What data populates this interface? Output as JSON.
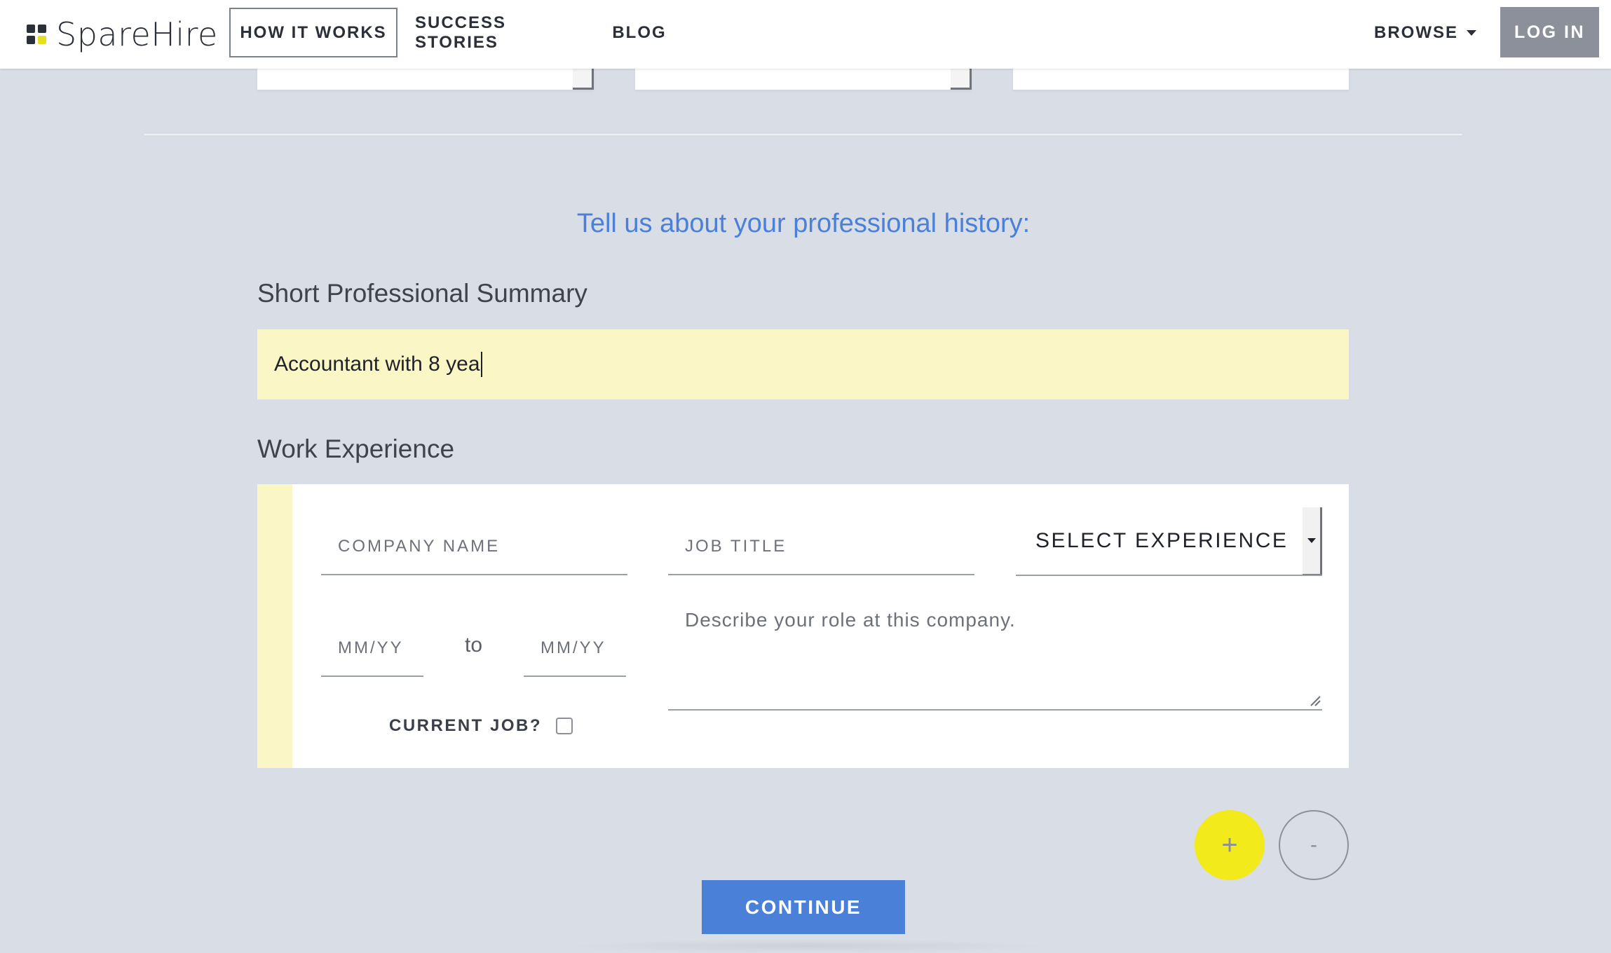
{
  "nav": {
    "logo_text": "SpareHire",
    "items": [
      {
        "label": "HOW IT WORKS"
      },
      {
        "label": "SUCCESS STORIES"
      },
      {
        "label": "BLOG"
      }
    ],
    "browse_label": "BROWSE",
    "login_label": "LOG IN"
  },
  "form": {
    "section_title": "Tell us about your professional history:",
    "summary_label": "Short Professional Summary",
    "summary_value": "Accountant with 8 yea",
    "work_label": "Work Experience",
    "company_placeholder": "COMPANY NAME",
    "job_title_placeholder": "JOB TITLE",
    "experience_select_value": "SELECT EXPERIENCE TYPE",
    "from_placeholder": "MM/YY",
    "to_text": "to",
    "to_placeholder": "MM/YY",
    "description_placeholder": "Describe your role at this company.",
    "current_job_label": "CURRENT JOB?",
    "current_job_checked": false,
    "add_label": "+",
    "remove_label": "-",
    "continue_label": "CONTINUE"
  },
  "colors": {
    "accent": "#4a80d8",
    "highlight": "#faf6c6",
    "add_button": "#f3ea1b",
    "background": "#d9dde6"
  },
  "icons": {
    "logo": "logo-grid-icon",
    "browse": "caret-down-icon",
    "select": "dropdown-arrow-icon",
    "resize": "resize-handle-icon"
  }
}
